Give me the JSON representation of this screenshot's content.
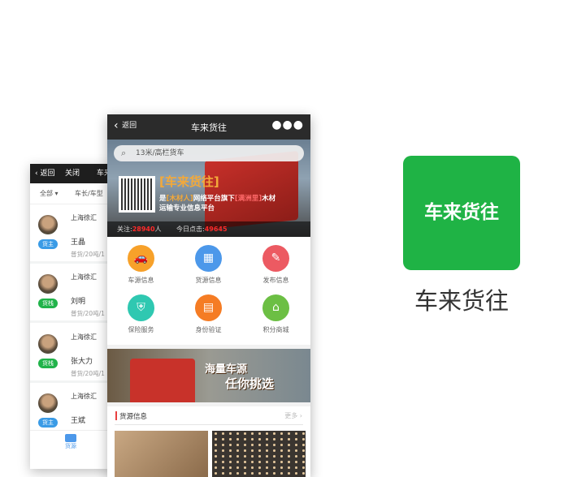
{
  "back_screen": {
    "back_label": "返回",
    "close_label": "关闭",
    "title_partial": "车来",
    "filter_all": "全部",
    "filter_length": "车长/车型",
    "items": [
      {
        "location": "上海徐汇",
        "name": "王晶",
        "detail": "普货/20吨/1",
        "badge": "货主",
        "badge_color": "#3a9be6"
      },
      {
        "location": "上海徐汇",
        "name": "刘明",
        "detail": "普货/20吨/1",
        "badge": "货栈",
        "badge_color": "#21b34a"
      },
      {
        "location": "上海徐汇",
        "name": "张大力",
        "detail": "普货/20吨/1",
        "badge": "货栈",
        "badge_color": "#21b34a"
      },
      {
        "location": "上海徐汇",
        "name": "王斌",
        "detail": "",
        "badge": "货主",
        "badge_color": "#3a9be6"
      }
    ],
    "tab_label": "货源"
  },
  "front_screen": {
    "back_label": "返回",
    "title": "车来货往",
    "search_placeholder": "13米/高栏货车",
    "banner_title": "[车来货往]",
    "banner_line1_a": "是",
    "banner_line1_b": "[木材人]",
    "banner_line1_c": "网络平台旗下",
    "banner_line1_d": "[满洲里]",
    "banner_line1_e": "木材",
    "banner_line2": "运输专业信息平台",
    "followers_label": "关注:",
    "followers": "28940",
    "followers_unit": "人",
    "clicks_label": "今日点击:",
    "clicks": "49645",
    "grid": [
      {
        "label": "车源信息",
        "icon": "car-icon",
        "color": "#f7a12a",
        "glyph": "🚗"
      },
      {
        "label": "货源信息",
        "icon": "grid-icon",
        "color": "#4c98ea",
        "glyph": "▦"
      },
      {
        "label": "发布信息",
        "icon": "edit-icon",
        "color": "#ec5a62",
        "glyph": "✎"
      },
      {
        "label": "保险服务",
        "icon": "shield-icon",
        "color": "#2fc8b1",
        "glyph": "⛨"
      },
      {
        "label": "身份验证",
        "icon": "id-card-icon",
        "color": "#f57c24",
        "glyph": "▤"
      },
      {
        "label": "积分商城",
        "icon": "shop-icon",
        "color": "#6cbf44",
        "glyph": "⌂"
      }
    ],
    "promo_line1": "海量车源",
    "promo_line2": "任你挑选",
    "section_title": "货源信息",
    "more_label": "更多"
  },
  "app": {
    "icon_text": "车来货往",
    "name": "车来货往",
    "brand_color": "#1fb345"
  }
}
